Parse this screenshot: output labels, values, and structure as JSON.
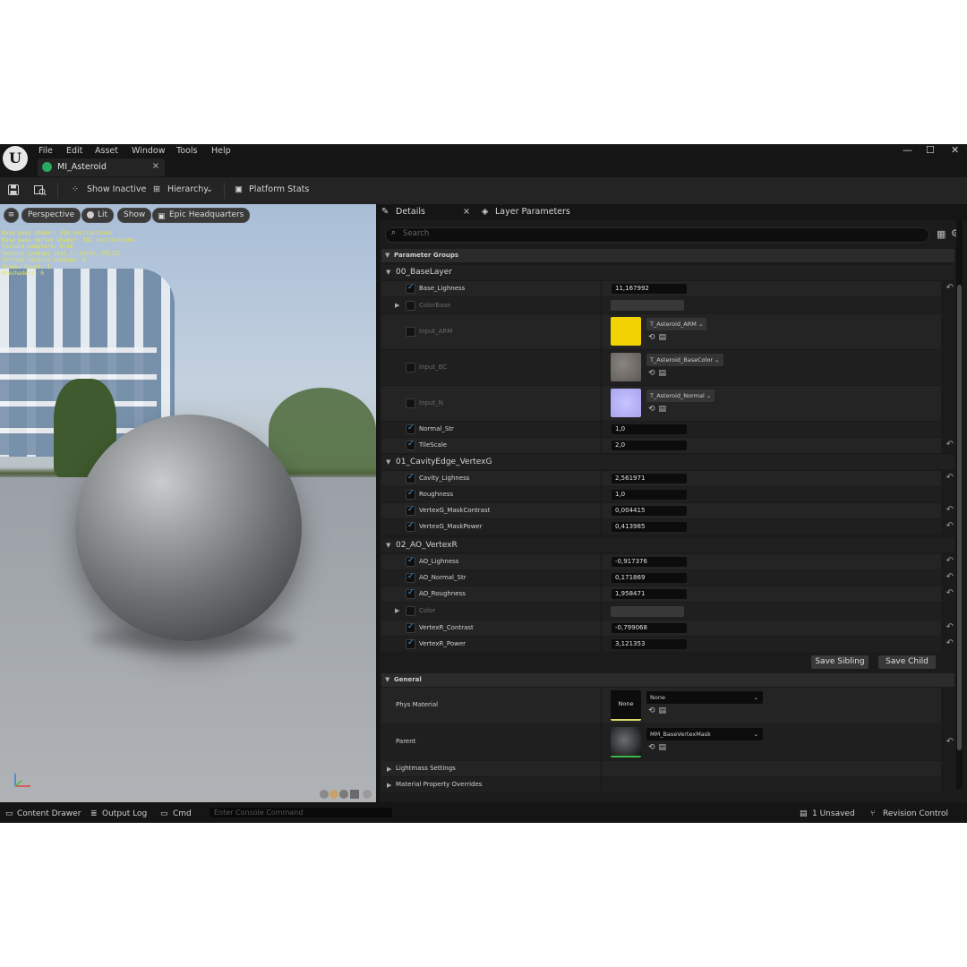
{
  "menu": [
    "File",
    "Edit",
    "Asset",
    "Window",
    "Tools",
    "Help"
  ],
  "asset_tab": {
    "label": "MI_Asteroid",
    "close": "×"
  },
  "window_controls": {
    "minimize": "—",
    "maximize": "☐",
    "close": "✕"
  },
  "toolbar": {
    "save_icon": "save-icon",
    "browse_icon": "browse-icon",
    "show_inactive": "Show Inactive",
    "hierarchy": "Hierarchy",
    "platform_stats": "Platform Stats"
  },
  "viewport": {
    "menu_icon": "≡",
    "perspective": "Perspective",
    "lit": "Lit",
    "show": "Show",
    "preview_scene": "Epic Headquarters",
    "stats_lines": [
      "Base pass shader: 318 instructions",
      "Base pass vertex shader: 152 instructions",
      "Texture samplers: 6/16",
      "Texture Lookups (Est.): VS(0), PS(12)",
      "Virtual Texture Lookups: 0",
      "Shader Count: 1",
      "Preshaders: 0"
    ]
  },
  "details": {
    "tab_details": "Details",
    "tab_close": "×",
    "tab_layer_params": "Layer Parameters",
    "search_placeholder": "Search",
    "parameter_groups_header": "Parameter Groups",
    "groups": [
      {
        "name": "00_BaseLayer"
      },
      {
        "name": "01_CavityEdge_VertexG"
      },
      {
        "name": "02_AO_VertexR"
      }
    ],
    "params": {
      "base_lighness": {
        "label": "Base_Lighness",
        "value": "11,167992",
        "checked": true
      },
      "colorbase": {
        "label": "ColorBase",
        "checked": false
      },
      "input_arm": {
        "label": "Input_ARM",
        "texture": "T_Asteroid_ARM",
        "checked": false
      },
      "input_bc": {
        "label": "Input_BC",
        "texture": "T_Asteroid_BaseColor",
        "checked": false
      },
      "input_n": {
        "label": "Input_N",
        "texture": "T_Asteroid_Normal",
        "checked": false
      },
      "normal_str": {
        "label": "Normal_Str",
        "value": "1,0",
        "checked": true
      },
      "tilescale": {
        "label": "TileScale",
        "value": "2,0",
        "checked": true
      },
      "cavity_lighness": {
        "label": "Cavity_Lighness",
        "value": "2,561971",
        "checked": true
      },
      "roughness": {
        "label": "Roughness",
        "value": "1,0",
        "checked": true
      },
      "vertexg_maskcontrast": {
        "label": "VertexG_MaskContrast",
        "value": "0,004415",
        "checked": true
      },
      "vertexg_maskpower": {
        "label": "VertexG_MaskPower",
        "value": "0,413985",
        "checked": true
      },
      "ao_lighness": {
        "label": "AO_Lighness",
        "value": "-0,917376",
        "checked": true
      },
      "ao_normal_str": {
        "label": "AO_Normal_Str",
        "value": "0,171869",
        "checked": true
      },
      "ao_roughness": {
        "label": "AO_Roughness",
        "value": "1,958471",
        "checked": true
      },
      "color": {
        "label": "Color",
        "checked": false
      },
      "vertexr_contrast": {
        "label": "VertexR_Contrast",
        "value": "-0,799068",
        "checked": true
      },
      "vertexr_power": {
        "label": "VertexR_Power",
        "value": "3,121353",
        "checked": true
      }
    },
    "save_sibling": "Save Sibling",
    "save_child": "Save Child",
    "general_header": "General",
    "phys_material": {
      "label": "Phys Material",
      "thumb_text": "None",
      "value": "None"
    },
    "parent": {
      "label": "Parent",
      "value": "MM_BaseVertexMask"
    },
    "lightmass_settings": "Lightmass Settings",
    "material_property_overrides": "Material Property Overrides"
  },
  "bottom_bar": {
    "content_drawer": "Content Drawer",
    "output_log": "Output Log",
    "cmd": "Cmd",
    "console_placeholder": "Enter Console Command",
    "unsaved": "1 Unsaved",
    "revision_control": "Revision Control"
  },
  "colors": {
    "accent_blue": "#3aa0f0",
    "asset_green": "#29a85f",
    "arm_yellow": "#f2d200"
  }
}
